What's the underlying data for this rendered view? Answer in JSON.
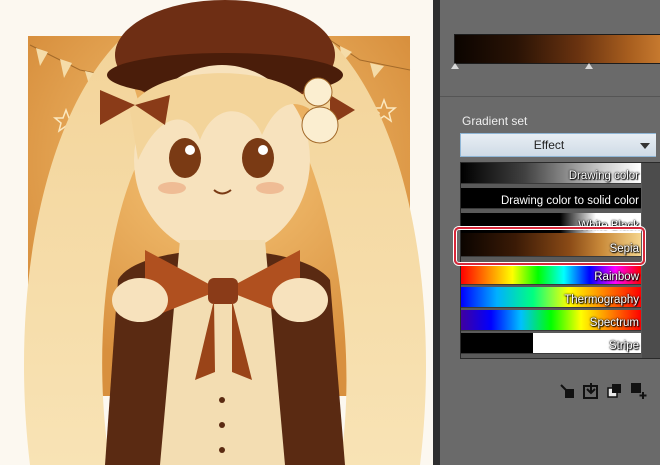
{
  "panel": {
    "section_label": "Gradient set",
    "dropdown_value": "Effect",
    "gradients": [
      {
        "label": "Drawing color",
        "selected": false
      },
      {
        "label": "Drawing color to solid color",
        "selected": false
      },
      {
        "label": "White Black",
        "selected": false
      },
      {
        "label": "Sepia",
        "selected": true
      },
      {
        "label": "Rainbow",
        "selected": false
      },
      {
        "label": "Thermography",
        "selected": false
      },
      {
        "label": "Spectrum",
        "selected": false
      },
      {
        "label": "Stripe",
        "selected": false
      }
    ],
    "toolbar_icons": [
      "delete-icon",
      "import-icon",
      "duplicate-icon",
      "add-icon"
    ]
  },
  "colors": {
    "panel_bg": "#6a6a6a",
    "selection": "#d8283a",
    "sepia_dark": "#0b0400",
    "sepia_light": "#f5d58c"
  }
}
